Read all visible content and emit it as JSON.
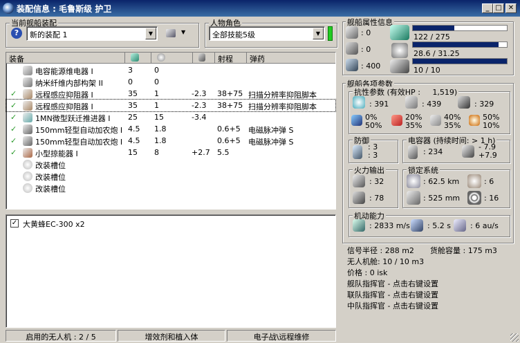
{
  "window": {
    "title": "装配信息 : 毛鲁斯级 护卫"
  },
  "fitting": {
    "label": "当前舰船装配",
    "current": "新的装配 1"
  },
  "character": {
    "label": "人物角色",
    "current": "全部技能5级"
  },
  "modules_table": {
    "headers": {
      "name": "装备",
      "col1_icon": "cpu-icon",
      "col2_icon": "powergrid-icon",
      "col3_icon": "capacitor-icon",
      "range": "射程",
      "ammo": "弹药"
    },
    "rows": [
      {
        "name": "电容能源维电器 I",
        "checked": false,
        "c1": "3",
        "c2": "0",
        "c3": "",
        "range": "",
        "ammo": ""
      },
      {
        "name": "纳米纤维内部构架 II",
        "checked": false,
        "c1": "0",
        "c2": "0",
        "c3": "",
        "range": "",
        "ammo": ""
      },
      {
        "name": "远程感应抑阻器 I",
        "checked": true,
        "c1": "35",
        "c2": "1",
        "c3": "-2.3",
        "range": "38+75",
        "ammo": "扫描分辨率抑阻脚本"
      },
      {
        "name": "远程感应抑阻器 I",
        "checked": true,
        "c1": "35",
        "c2": "1",
        "c3": "-2.3",
        "range": "38+75",
        "ammo": "扫描分辨率抑阻脚本"
      },
      {
        "name": "1MN微型跃迁推进器 I",
        "checked": true,
        "c1": "25",
        "c2": "15",
        "c3": "-3.4",
        "range": "",
        "ammo": ""
      },
      {
        "name": "150mm轻型自动加农炮 I",
        "checked": true,
        "c1": "4.5",
        "c2": "1.8",
        "c3": "",
        "range": "0.6+5",
        "ammo": "电磁脉冲弹 S"
      },
      {
        "name": "150mm轻型自动加农炮 I",
        "checked": true,
        "c1": "4.5",
        "c2": "1.8",
        "c3": "",
        "range": "0.6+5",
        "ammo": "电磁脉冲弹 S"
      },
      {
        "name": "小型掠能器 I",
        "checked": true,
        "c1": "15",
        "c2": "8",
        "c3": "+2.7",
        "range": "5.5",
        "ammo": ""
      },
      {
        "name": "改装槽位",
        "checked": false,
        "c1": "",
        "c2": "",
        "c3": "",
        "range": "",
        "ammo": ""
      },
      {
        "name": "改装槽位",
        "checked": false,
        "c1": "",
        "c2": "",
        "c3": "",
        "range": "",
        "ammo": ""
      },
      {
        "name": "改装槽位",
        "checked": false,
        "c1": "",
        "c2": "",
        "c3": "",
        "range": "",
        "ammo": ""
      }
    ]
  },
  "drones_list": {
    "items": [
      {
        "label": "大黄蜂EC-300 x2",
        "checked": true
      }
    ]
  },
  "statusbar": {
    "drones": "启用的无人机 : 2 / 5",
    "boosters": "增效剂和植入体",
    "ewar": "电子战\\远程维修"
  },
  "ship_attrs": {
    "label": "舰船属性信息",
    "turrets": ": 0",
    "launchers": ": 0",
    "calibration": ": 400",
    "cpu_text": "122 / 275",
    "cpu_fraction": 0.444,
    "power_text": "28.6 / 31.25",
    "power_fraction": 0.915,
    "drone_bw_text": "10 / 10",
    "drone_bw_fraction": 1.0
  },
  "ship_params": {
    "label": "舰船各项参数",
    "resist": {
      "label": "抗性参数 (有效HP :",
      "ehp": "1,519)",
      "shield_hp": ": 391",
      "armor_hp": ": 439",
      "hull_hp": ": 329",
      "em": [
        "0%",
        "50%"
      ],
      "thermal": [
        "20%",
        "35%"
      ],
      "kinetic": [
        "40%",
        "35%"
      ],
      "explosive": [
        "50%",
        "10%"
      ]
    },
    "defense": {
      "label": "防御",
      "v1": ": 3",
      "v2": ": 3"
    },
    "capacitor": {
      "label": "电容器 (持续时间: > 1 h)",
      "capacity": ": 234",
      "delta1": "- 7.9",
      "delta2": "+7.9"
    },
    "firepower": {
      "label": "火力输出",
      "turret_dps": ": 32",
      "drone_dps": ": 78"
    },
    "targeting": {
      "label": "锁定系统",
      "range": ": 62.5 km",
      "max_targets": ": 6",
      "resolution": ": 525 mm",
      "sensor": ": 16"
    },
    "navigation": {
      "label": "机动能力",
      "speed": ": 2833 m/s",
      "align": ": 5.2 s",
      "warp": ": 6 au/s"
    },
    "misc": {
      "signature": "信号半径 : 288 m2",
      "cargo": "货舱容量 : 175 m3",
      "drone_bay": "无人机舱: 10 / 10 m3",
      "price": "价格 : 0 isk",
      "fleet": "舰队指挥官 - 点击右键设置",
      "wing": "联队指挥官 - 点击右键设置",
      "squad": "中队指挥官 - 点击右键设置"
    }
  },
  "colors": {
    "titlebar": "#0a246a",
    "bar": "#0a246a",
    "check": "#2a9a2a",
    "char_indicator": "#22cc22"
  }
}
